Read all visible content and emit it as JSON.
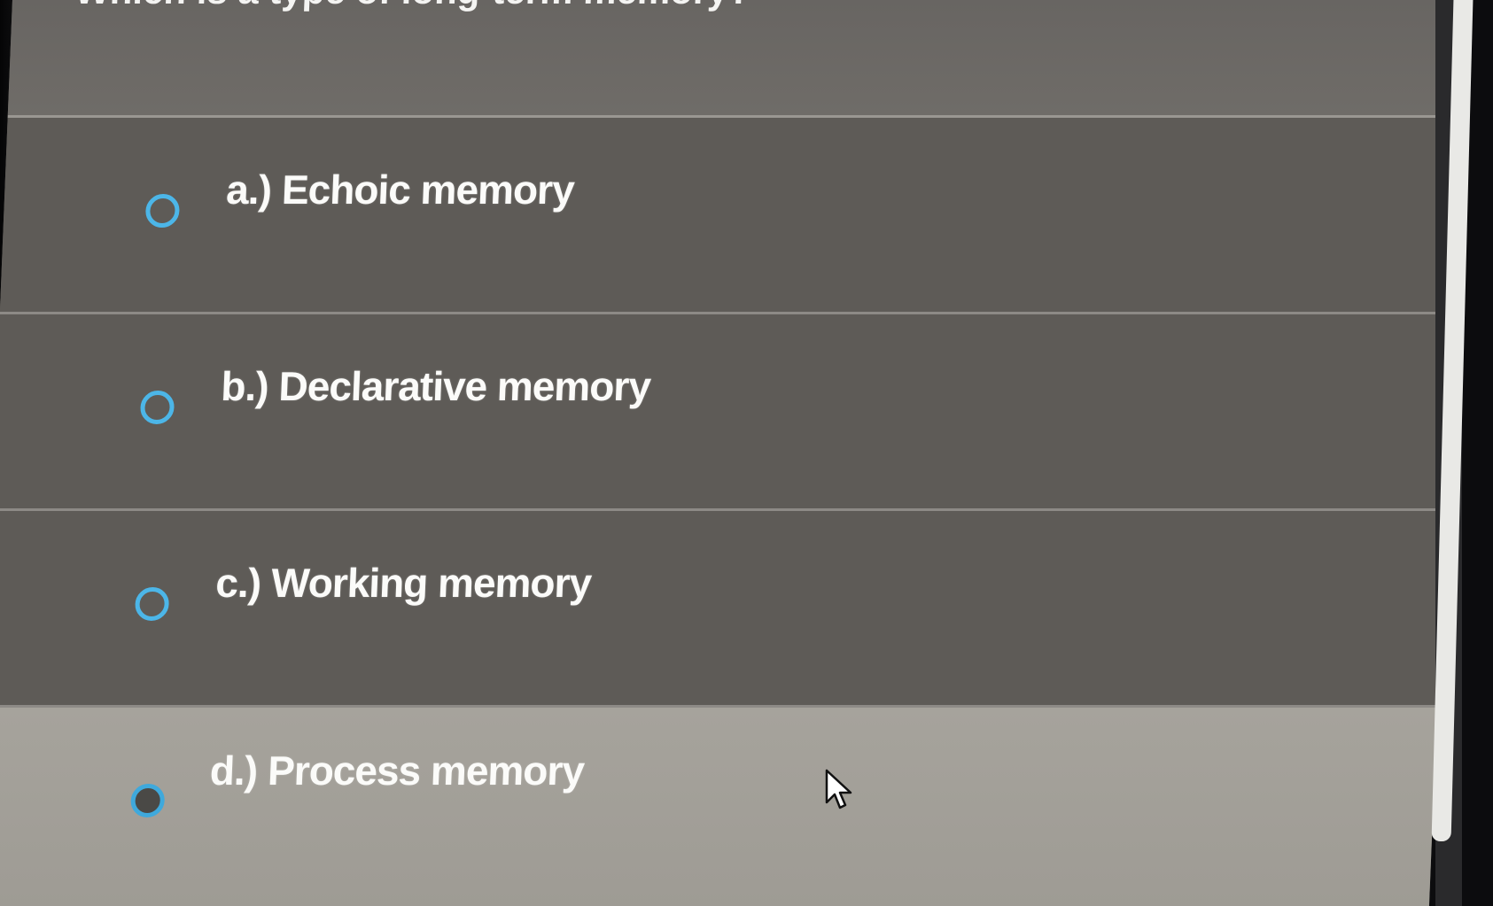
{
  "question": {
    "text": "Which is a type of long-term memory?"
  },
  "options": [
    {
      "letter": "a.)",
      "text": "Echoic memory",
      "selected": false
    },
    {
      "letter": "b.)",
      "text": "Declarative memory",
      "selected": false
    },
    {
      "letter": "c.)",
      "text": "Working memory",
      "selected": false
    },
    {
      "letter": "d.)",
      "text": "Process memory",
      "selected": false
    }
  ],
  "colors": {
    "radio_accent": "#4cb6e8",
    "option_background": "#5e5b57",
    "hovered_option_background": "#a6a39c",
    "text": "#fbfbf9"
  },
  "icons": {
    "pointer": "mouse-pointer-icon"
  }
}
